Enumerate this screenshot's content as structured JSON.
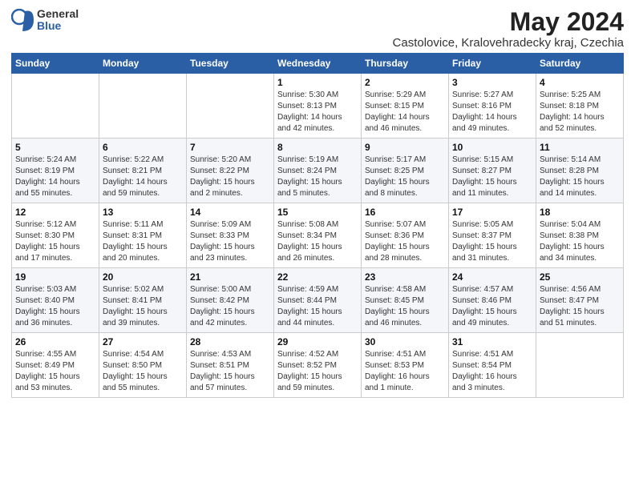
{
  "header": {
    "logo_general": "General",
    "logo_blue": "Blue",
    "title": "May 2024",
    "subtitle": "Castolovice, Kralovehradecky kraj, Czechia"
  },
  "days_of_week": [
    "Sunday",
    "Monday",
    "Tuesday",
    "Wednesday",
    "Thursday",
    "Friday",
    "Saturday"
  ],
  "weeks": [
    [
      {
        "day": "",
        "info": ""
      },
      {
        "day": "",
        "info": ""
      },
      {
        "day": "",
        "info": ""
      },
      {
        "day": "1",
        "info": "Sunrise: 5:30 AM\nSunset: 8:13 PM\nDaylight: 14 hours\nand 42 minutes."
      },
      {
        "day": "2",
        "info": "Sunrise: 5:29 AM\nSunset: 8:15 PM\nDaylight: 14 hours\nand 46 minutes."
      },
      {
        "day": "3",
        "info": "Sunrise: 5:27 AM\nSunset: 8:16 PM\nDaylight: 14 hours\nand 49 minutes."
      },
      {
        "day": "4",
        "info": "Sunrise: 5:25 AM\nSunset: 8:18 PM\nDaylight: 14 hours\nand 52 minutes."
      }
    ],
    [
      {
        "day": "5",
        "info": "Sunrise: 5:24 AM\nSunset: 8:19 PM\nDaylight: 14 hours\nand 55 minutes."
      },
      {
        "day": "6",
        "info": "Sunrise: 5:22 AM\nSunset: 8:21 PM\nDaylight: 14 hours\nand 59 minutes."
      },
      {
        "day": "7",
        "info": "Sunrise: 5:20 AM\nSunset: 8:22 PM\nDaylight: 15 hours\nand 2 minutes."
      },
      {
        "day": "8",
        "info": "Sunrise: 5:19 AM\nSunset: 8:24 PM\nDaylight: 15 hours\nand 5 minutes."
      },
      {
        "day": "9",
        "info": "Sunrise: 5:17 AM\nSunset: 8:25 PM\nDaylight: 15 hours\nand 8 minutes."
      },
      {
        "day": "10",
        "info": "Sunrise: 5:15 AM\nSunset: 8:27 PM\nDaylight: 15 hours\nand 11 minutes."
      },
      {
        "day": "11",
        "info": "Sunrise: 5:14 AM\nSunset: 8:28 PM\nDaylight: 15 hours\nand 14 minutes."
      }
    ],
    [
      {
        "day": "12",
        "info": "Sunrise: 5:12 AM\nSunset: 8:30 PM\nDaylight: 15 hours\nand 17 minutes."
      },
      {
        "day": "13",
        "info": "Sunrise: 5:11 AM\nSunset: 8:31 PM\nDaylight: 15 hours\nand 20 minutes."
      },
      {
        "day": "14",
        "info": "Sunrise: 5:09 AM\nSunset: 8:33 PM\nDaylight: 15 hours\nand 23 minutes."
      },
      {
        "day": "15",
        "info": "Sunrise: 5:08 AM\nSunset: 8:34 PM\nDaylight: 15 hours\nand 26 minutes."
      },
      {
        "day": "16",
        "info": "Sunrise: 5:07 AM\nSunset: 8:36 PM\nDaylight: 15 hours\nand 28 minutes."
      },
      {
        "day": "17",
        "info": "Sunrise: 5:05 AM\nSunset: 8:37 PM\nDaylight: 15 hours\nand 31 minutes."
      },
      {
        "day": "18",
        "info": "Sunrise: 5:04 AM\nSunset: 8:38 PM\nDaylight: 15 hours\nand 34 minutes."
      }
    ],
    [
      {
        "day": "19",
        "info": "Sunrise: 5:03 AM\nSunset: 8:40 PM\nDaylight: 15 hours\nand 36 minutes."
      },
      {
        "day": "20",
        "info": "Sunrise: 5:02 AM\nSunset: 8:41 PM\nDaylight: 15 hours\nand 39 minutes."
      },
      {
        "day": "21",
        "info": "Sunrise: 5:00 AM\nSunset: 8:42 PM\nDaylight: 15 hours\nand 42 minutes."
      },
      {
        "day": "22",
        "info": "Sunrise: 4:59 AM\nSunset: 8:44 PM\nDaylight: 15 hours\nand 44 minutes."
      },
      {
        "day": "23",
        "info": "Sunrise: 4:58 AM\nSunset: 8:45 PM\nDaylight: 15 hours\nand 46 minutes."
      },
      {
        "day": "24",
        "info": "Sunrise: 4:57 AM\nSunset: 8:46 PM\nDaylight: 15 hours\nand 49 minutes."
      },
      {
        "day": "25",
        "info": "Sunrise: 4:56 AM\nSunset: 8:47 PM\nDaylight: 15 hours\nand 51 minutes."
      }
    ],
    [
      {
        "day": "26",
        "info": "Sunrise: 4:55 AM\nSunset: 8:49 PM\nDaylight: 15 hours\nand 53 minutes."
      },
      {
        "day": "27",
        "info": "Sunrise: 4:54 AM\nSunset: 8:50 PM\nDaylight: 15 hours\nand 55 minutes."
      },
      {
        "day": "28",
        "info": "Sunrise: 4:53 AM\nSunset: 8:51 PM\nDaylight: 15 hours\nand 57 minutes."
      },
      {
        "day": "29",
        "info": "Sunrise: 4:52 AM\nSunset: 8:52 PM\nDaylight: 15 hours\nand 59 minutes."
      },
      {
        "day": "30",
        "info": "Sunrise: 4:51 AM\nSunset: 8:53 PM\nDaylight: 16 hours\nand 1 minute."
      },
      {
        "day": "31",
        "info": "Sunrise: 4:51 AM\nSunset: 8:54 PM\nDaylight: 16 hours\nand 3 minutes."
      },
      {
        "day": "",
        "info": ""
      }
    ]
  ]
}
